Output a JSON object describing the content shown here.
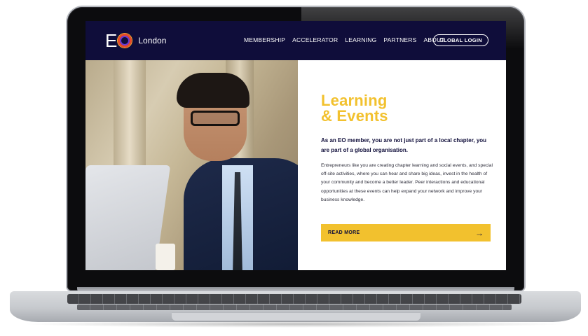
{
  "site": {
    "logo_text": "London",
    "logo_letter": "E"
  },
  "nav": {
    "items": [
      {
        "label": "MEMBERSHIP"
      },
      {
        "label": "ACCELERATOR"
      },
      {
        "label": "LEARNING"
      },
      {
        "label": "PARTNERS"
      },
      {
        "label": "ABOUT"
      }
    ],
    "login_label": "GLOBAL LOGIN"
  },
  "hero": {
    "title_line1": "Learning",
    "title_line2": "& Events",
    "lead": "As an EO member, you are not just part of a local chapter, you are part of a global organisation.",
    "body": "Entrepreneurs like you are creating chapter learning and social events, and special off-site activities, where you can hear and share big ideas, invest in the health of your community and become a better leader. Peer interactions and educational opportunities at these events can help expand your network and improve your business knowledge.",
    "cta_label": "READ MORE",
    "cta_arrow": "→"
  },
  "colors": {
    "nav_bg": "#0f0d3a",
    "accent": "#f2c12e",
    "text_dark": "#0f0d3a"
  }
}
